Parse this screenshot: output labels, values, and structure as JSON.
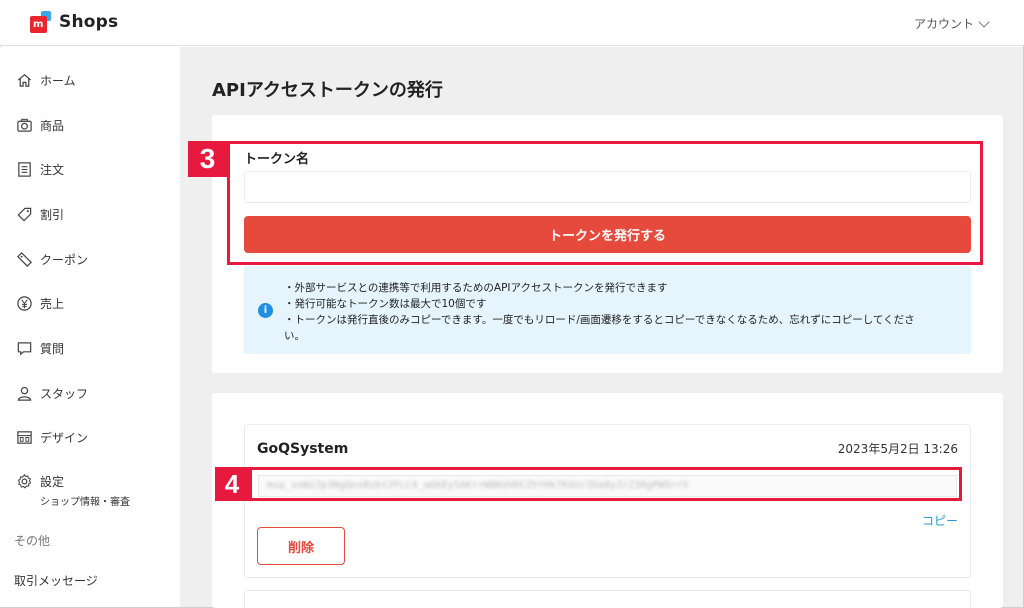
{
  "header": {
    "logo_text": "Shops",
    "account_label": "アカウント"
  },
  "sidebar": {
    "items": [
      {
        "label": "ホーム",
        "icon": "home-icon"
      },
      {
        "label": "商品",
        "icon": "camera-icon"
      },
      {
        "label": "注文",
        "icon": "list-icon"
      },
      {
        "label": "割引",
        "icon": "tag-icon"
      },
      {
        "label": "クーポン",
        "icon": "coupon-icon"
      },
      {
        "label": "売上",
        "icon": "yen-icon"
      },
      {
        "label": "質問",
        "icon": "chat-icon"
      },
      {
        "label": "スタッフ",
        "icon": "user-icon"
      },
      {
        "label": "デザイン",
        "icon": "design-icon"
      },
      {
        "label": "設定",
        "icon": "gear-icon",
        "sub": "ショップ情報・審査"
      }
    ],
    "other_label": "その他",
    "messages_label": "取引メッセージ"
  },
  "main": {
    "title": "APIアクセストークンの発行",
    "token_form": {
      "field_label": "トークン名",
      "field_value": "",
      "issue_button": "トークンを発行する"
    },
    "info": {
      "lines": [
        "・外部サービスとの連携等で利用するためのAPIアクセストークンを発行できます",
        "・発行可能なトークン数は最大で10個です",
        "・トークンは発行直後のみコピーできます。一度でもリロード/画面遷移をするとコピーできなくなるため、忘れずにコピーしてくださ",
        "い。"
      ]
    },
    "token": {
      "name": "GoQSystem",
      "date": "2023年5月2日 13:26",
      "value": "msp_xeWzZp3NgQexBzbt2FLC4_aQkEySAKrrW8KUVDCZhYHk7KXUrZDa8yZrZ3RgPW5rrV",
      "copy_label": "コピー",
      "delete_label": "削除"
    }
  },
  "annotations": {
    "badge3": "3",
    "badge4": "4",
    "color": "#e8193f"
  },
  "colors": {
    "accent_red": "#e64a3d",
    "info_bg": "#e6f5fd",
    "link_blue": "#2b9bd8"
  }
}
